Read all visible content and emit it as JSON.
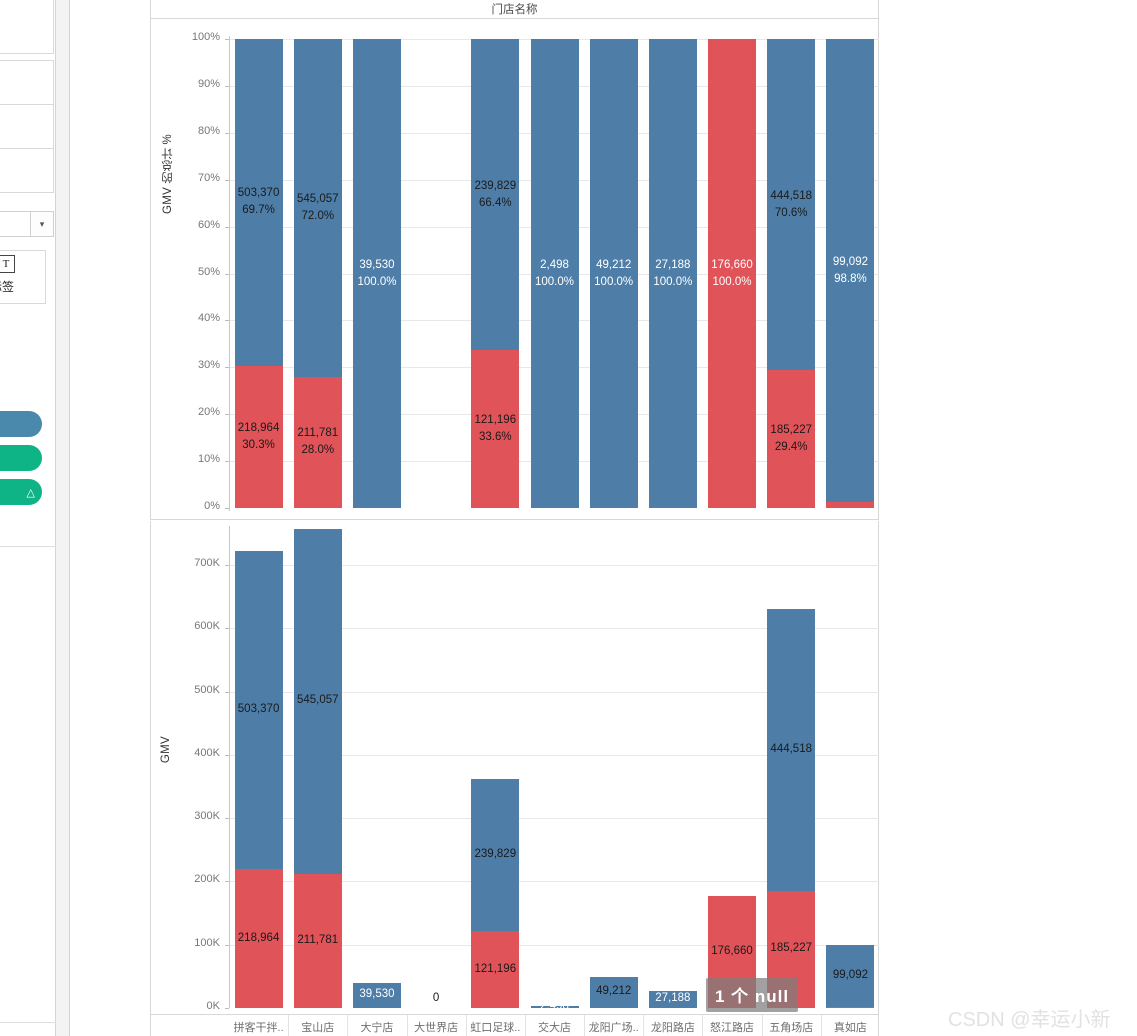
{
  "window": {
    "watermark": "CSDN @幸运小新"
  },
  "sidebar": {
    "marks_text_icon": "T",
    "marks_label": "标签",
    "dropdown_arrow": "▾",
    "pills": [
      {
        "name": "pill-blue",
        "glyph": "",
        "color": "#4a89ab"
      },
      {
        "name": "pill-green-1",
        "glyph": "",
        "color": "#0fb486"
      },
      {
        "name": "pill-green-2",
        "glyph": "△",
        "color": "#0fb486"
      }
    ]
  },
  "header": {
    "title": "门店名称"
  },
  "tooltip": {
    "null_badge": "1 个 null"
  },
  "chart_data": [
    {
      "type": "bar",
      "id": "percent-of-total",
      "title": "门店名称",
      "xlabel": "",
      "ylabel": "GMV 的总计 %",
      "stacked": true,
      "normalized": true,
      "ylim": [
        0,
        100
      ],
      "yticks": [
        "0%",
        "10%",
        "20%",
        "30%",
        "40%",
        "50%",
        "60%",
        "70%",
        "80%",
        "90%",
        "100%"
      ],
      "grid": true,
      "legend": null,
      "colors": {
        "blue": "#4e7ea8",
        "red": "#e05358"
      },
      "categories": [
        "拼客干拌..",
        "宝山店",
        "大宁店",
        "大世界店",
        "虹口足球..",
        "交大店",
        "龙阳广场..",
        "龙阳路店",
        "怒江路店",
        "五角场店",
        "真如店"
      ],
      "series": [
        {
          "name": "blue",
          "values": [
            69.7,
            72.0,
            100.0,
            null,
            66.4,
            100.0,
            100.0,
            100.0,
            0.0,
            70.6,
            98.8
          ],
          "labels": [
            "503,370\n69.7%",
            "545,057\n72.0%",
            "39,530\n100.0%",
            "",
            "239,829\n66.4%",
            "2,498\n100.0%",
            "49,212\n100.0%",
            "27,188\n100.0%",
            "",
            "444,518\n70.6%",
            "99,092\n98.8%"
          ]
        },
        {
          "name": "red",
          "values": [
            30.3,
            28.0,
            0.0,
            null,
            33.6,
            0.0,
            0.0,
            0.0,
            100.0,
            29.4,
            1.2
          ],
          "labels": [
            "218,964\n30.3%",
            "211,781\n28.0%",
            "",
            "",
            "121,196\n33.6%",
            "",
            "",
            "",
            "176,660\n100.0%",
            "185,227\n29.4%",
            ""
          ]
        }
      ]
    },
    {
      "type": "bar",
      "id": "gmv-absolute",
      "title": "",
      "xlabel": "",
      "ylabel": "GMV",
      "stacked": true,
      "ylim": [
        0,
        780000
      ],
      "yticks": [
        "0K",
        "100K",
        "200K",
        "300K",
        "400K",
        "500K",
        "600K",
        "700K"
      ],
      "grid": true,
      "colors": {
        "blue": "#4e7ea8",
        "red": "#e05358"
      },
      "categories": [
        "拼客干拌..",
        "宝山店",
        "大宁店",
        "大世界店",
        "虹口足球..",
        "交大店",
        "龙阳广场..",
        "龙阳路店",
        "怒江路店",
        "五角场店",
        "真如店"
      ],
      "series": [
        {
          "name": "blue",
          "values": [
            503370,
            545057,
            39530,
            0,
            239829,
            2498,
            49212,
            27188,
            0,
            444518,
            99092
          ],
          "labels": [
            "503,370",
            "545,057",
            "39,530",
            "0",
            "239,829",
            "2,498",
            "49,212",
            "27,188",
            "",
            "444,518",
            "99,092"
          ]
        },
        {
          "name": "red",
          "values": [
            218964,
            211781,
            0,
            0,
            121196,
            0,
            0,
            0,
            176660,
            185227,
            1200
          ],
          "labels": [
            "218,964",
            "211,781",
            "",
            "",
            "121,196",
            "",
            "",
            "",
            "176,660",
            "185,227",
            ""
          ]
        }
      ],
      "zero_label": "0"
    }
  ]
}
